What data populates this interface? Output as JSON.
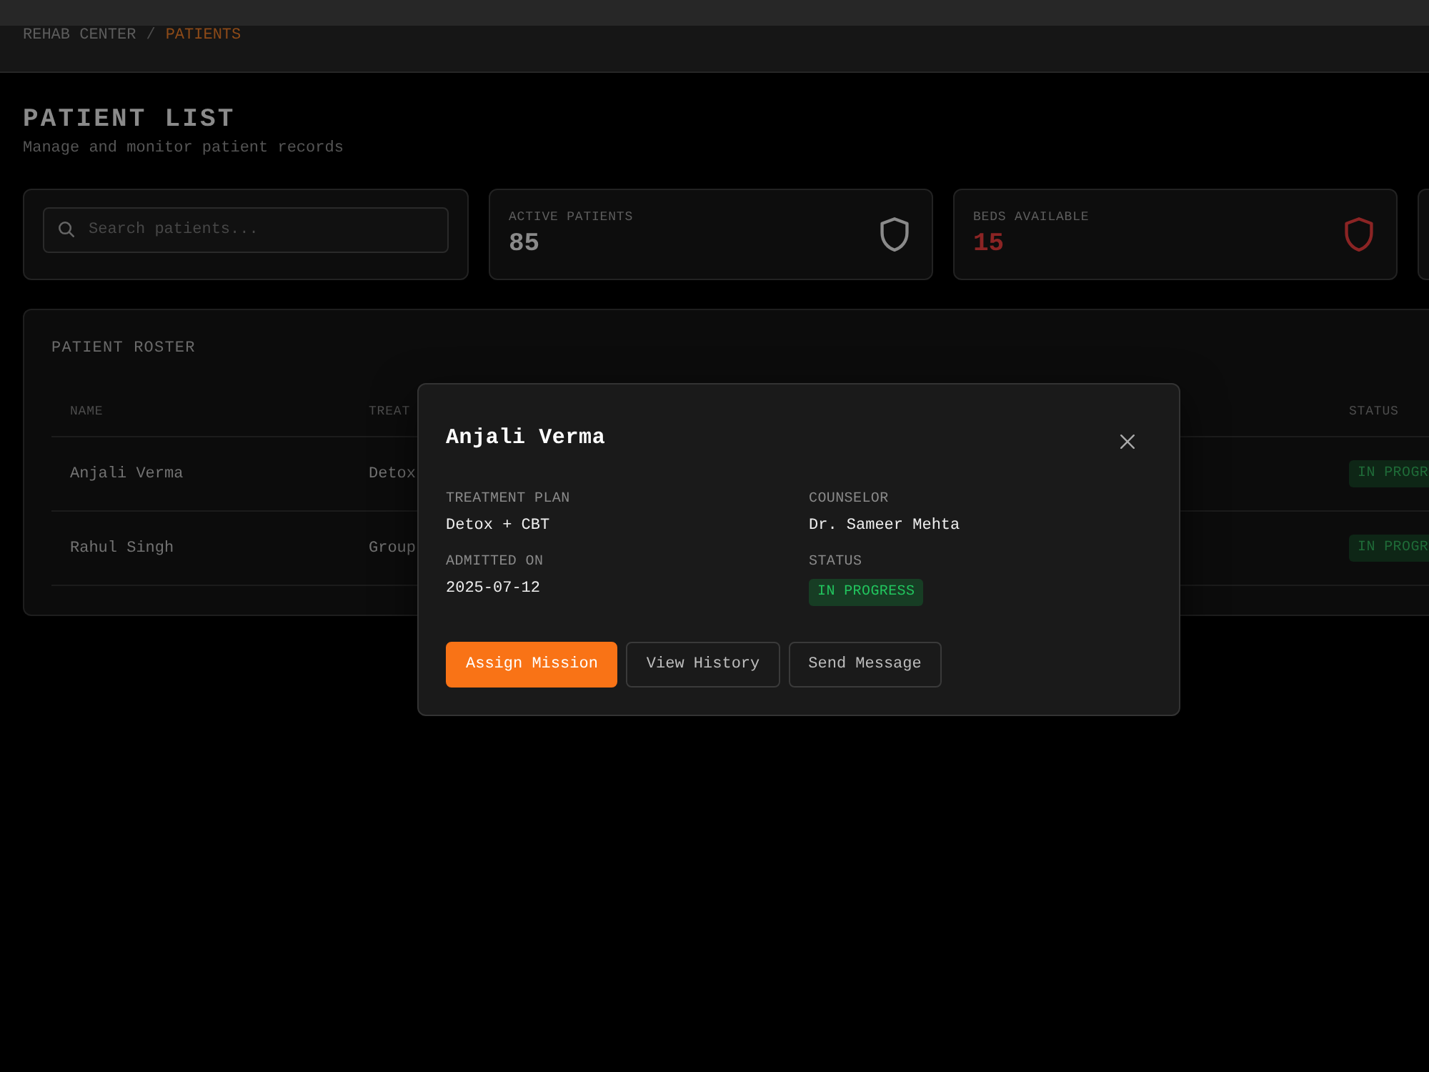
{
  "breadcrumb": {
    "items": [
      {
        "label": "REHAB CENTER",
        "selected": false
      },
      {
        "label": "PATIENTS",
        "selected": true
      }
    ],
    "separator": "/"
  },
  "page": {
    "title": "PATIENT LIST",
    "subtitle": "Manage and monitor patient records"
  },
  "search": {
    "placeholder": "Search patients..."
  },
  "stats": [
    {
      "label": "ACTIVE PATIENTS",
      "value": "85",
      "color": "#8a8a8a"
    },
    {
      "label": "BEDS AVAILABLE",
      "value": "15",
      "color": "#8b2424"
    }
  ],
  "roster": {
    "title": "PATIENT ROSTER",
    "columns": [
      "NAME",
      "TREAT",
      "STATUS"
    ],
    "rows": [
      {
        "name": "Anjali Verma",
        "treatment": "Detox",
        "status": "IN PROGR"
      },
      {
        "name": "Rahul Singh",
        "treatment": "Group",
        "status": "IN PROGR"
      }
    ]
  },
  "modal": {
    "title": "Anjali Verma",
    "fields": [
      {
        "label": "TREATMENT PLAN",
        "value": "Detox + CBT",
        "kind": "text"
      },
      {
        "label": "COUNSELOR",
        "value": "Dr. Sameer Mehta",
        "kind": "text"
      },
      {
        "label": "ADMITTED ON",
        "value": "2025-07-12",
        "kind": "text"
      },
      {
        "label": "STATUS",
        "value": "IN PROGRESS",
        "kind": "badge"
      }
    ],
    "buttons": [
      {
        "label": "Assign Mission",
        "primary": true
      },
      {
        "label": "View History",
        "primary": false
      },
      {
        "label": "Send Message",
        "primary": false
      }
    ]
  }
}
